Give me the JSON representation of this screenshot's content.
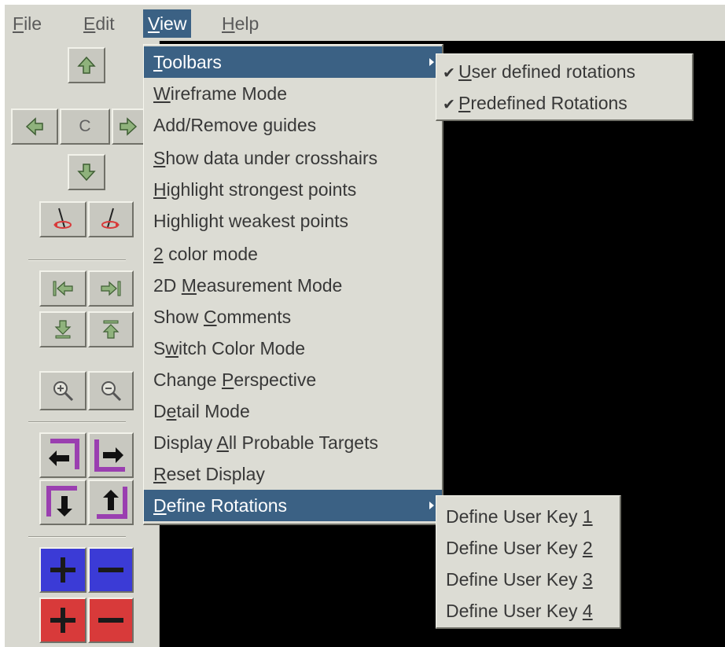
{
  "menubar": {
    "items": [
      {
        "pre": "",
        "key": "F",
        "post": "ile"
      },
      {
        "pre": "",
        "key": "E",
        "post": "dit"
      },
      {
        "pre": "",
        "key": "V",
        "post": "iew"
      },
      {
        "pre": "",
        "key": "H",
        "post": "elp"
      }
    ],
    "active": "View"
  },
  "toolbar": {
    "center_label": "C",
    "icons": [
      "up-arrow-icon",
      "left-arrow-icon",
      "center-button",
      "right-arrow-icon",
      "down-arrow-icon",
      "rotate-left-axis-icon",
      "rotate-right-axis-icon",
      "first-icon",
      "last-icon",
      "bottom-icon",
      "top-icon",
      "zoom-in-icon",
      "zoom-out-icon",
      "turn-left-icon",
      "turn-right-icon",
      "turn-down-icon",
      "turn-up-icon",
      "blue-plus-icon",
      "blue-minus-icon",
      "red-plus-icon",
      "red-minus-icon"
    ],
    "colors": {
      "blue": "#3b3bd6",
      "red": "#d83a3a",
      "purple": "#9a3fb0"
    }
  },
  "view_menu": {
    "items": [
      {
        "pre": "",
        "key": "T",
        "post": "oolbars",
        "submenu": true
      },
      {
        "pre": "",
        "key": "W",
        "post": "ireframe Mode"
      },
      {
        "pre": "Add/Remove ",
        "key": "g",
        "post": "uides"
      },
      {
        "pre": "",
        "key": "S",
        "post": "how data under crosshairs"
      },
      {
        "pre": "",
        "key": "H",
        "post": "ighlight strongest points"
      },
      {
        "pre": "Highlight weakest points",
        "key": "",
        "post": ""
      },
      {
        "pre": "",
        "key": "2",
        "post": " color mode"
      },
      {
        "pre": "2D ",
        "key": "M",
        "post": "easurement Mode"
      },
      {
        "pre": "Show ",
        "key": "C",
        "post": "omments"
      },
      {
        "pre": "S",
        "key": "w",
        "post": "itch Color Mode"
      },
      {
        "pre": "Change ",
        "key": "P",
        "post": "erspective"
      },
      {
        "pre": "D",
        "key": "e",
        "post": "tail Mode"
      },
      {
        "pre": "Display ",
        "key": "A",
        "post": "ll Probable Targets"
      },
      {
        "pre": "",
        "key": "R",
        "post": "eset Display"
      },
      {
        "pre": "",
        "key": "D",
        "post": "efine Rotations",
        "submenu": true
      }
    ]
  },
  "toolbars_submenu": {
    "check_mark": "✔",
    "items": [
      {
        "pre": "",
        "key": "U",
        "post": "ser defined rotations",
        "checked": true
      },
      {
        "pre": "",
        "key": "P",
        "post": "redefined Rotations",
        "checked": true
      }
    ]
  },
  "rotations_submenu": {
    "items": [
      {
        "pre": "Define User Key ",
        "key": "1",
        "post": ""
      },
      {
        "pre": "Define User Key ",
        "key": "2",
        "post": ""
      },
      {
        "pre": "Define User Key ",
        "key": "3",
        "post": ""
      },
      {
        "pre": "Define User Key ",
        "key": "4",
        "post": ""
      }
    ]
  },
  "theme": {
    "menu_bg": "#dcdcd4",
    "highlight": "#3b6184",
    "canvas": "#000000"
  }
}
